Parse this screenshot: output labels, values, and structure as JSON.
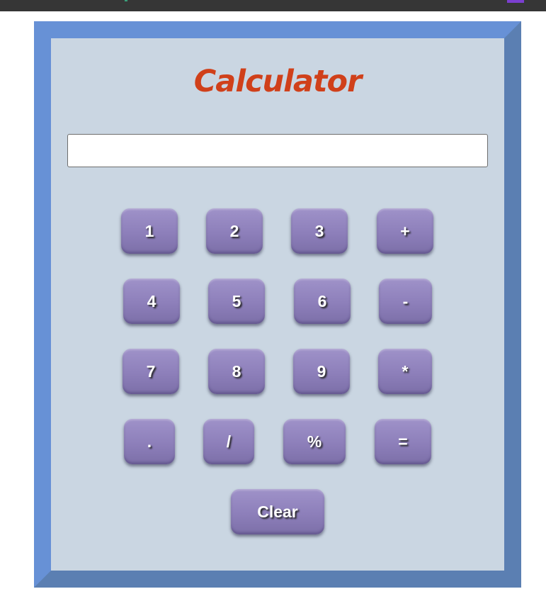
{
  "app": {
    "title": "Calculator",
    "display_value": "",
    "accent_color": "#d0401a",
    "frame_color": "#6791d6",
    "panel_color": "#cad6e2",
    "key_color": "#8d7fba"
  },
  "keys": {
    "k1": "1",
    "k2": "2",
    "k3": "3",
    "plus": "+",
    "k4": "4",
    "k5": "5",
    "k6": "6",
    "minus": "-",
    "k7": "7",
    "k8": "8",
    "k9": "9",
    "multiply": "*",
    "dot": ".",
    "divide": "/",
    "percent": "%",
    "equals": "=",
    "clear": "Clear"
  }
}
